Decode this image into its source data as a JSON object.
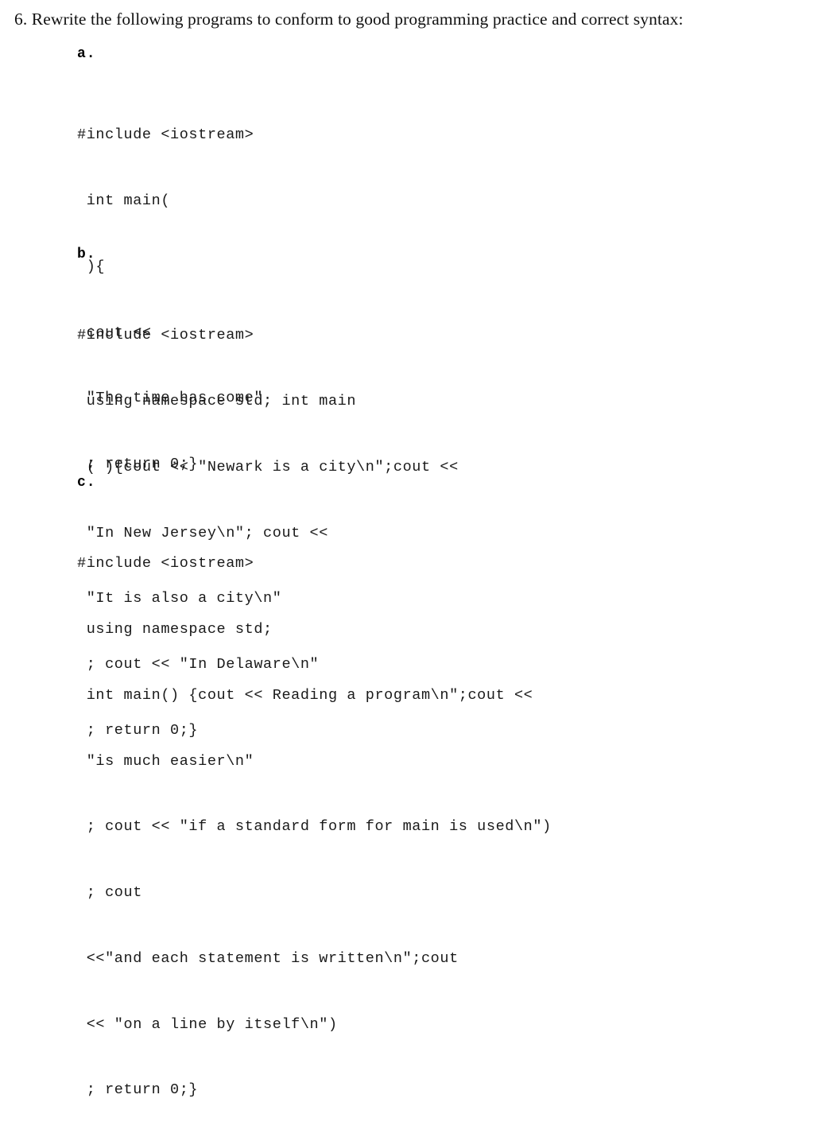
{
  "document": {
    "question_number": "6.",
    "heading": "6. Rewrite the following programs to conform to good programming practice and correct syntax:",
    "background_color": "#ffffff",
    "text_color": "#000000"
  },
  "parts": [
    {
      "label": "a.",
      "code": "#include <iostream>\n int main(\n ){\n cout <<\n \"The time has come\"\n ; return 0;}",
      "lines": [
        "#include <iostream>",
        " int main(",
        " ){",
        " cout <<",
        " \"The time has come\"",
        " ; return 0;}"
      ]
    },
    {
      "label": "b.",
      "code": "#include <iostream>\n using namespace std; int main\n ( ){cout << \"Newark is a city\\n\";cout <<\n \"In New Jersey\\n\"; cout <<\n \"It is also a city\\n\"\n ; cout << \"In Delaware\\n\"\n ; return 0;}",
      "lines": [
        "#include <iostream>",
        " using namespace std; int main",
        " ( ){cout << \"Newark is a city\\n\";cout <<",
        " \"In New Jersey\\n\"; cout <<",
        " \"It is also a city\\n\"",
        " ; cout << \"In Delaware\\n\"",
        " ; return 0;}"
      ]
    },
    {
      "label": "c.",
      "code": "#include <iostream>\n using namespace std;\n int main() {cout << Reading a program\\n\";cout <<\n \"is much easier\\n\"\n ; cout << \"if a standard form for main is used\\n\")\n ; cout\n <<\"and each statement is written\\n\";cout\n << \"on a line by itself\\n\")\n ; return 0;}",
      "lines": [
        "#include <iostream>",
        " using namespace std;",
        " int main() {cout << Reading a program\\n\";cout <<",
        " \"is much easier\\n\"",
        " ; cout << \"if a standard form for main is used\\n\")",
        " ; cout",
        " <<\"and each statement is written\\n\";cout",
        " << \"on a line by itself\\n\")",
        " ; return 0;}"
      ]
    }
  ]
}
